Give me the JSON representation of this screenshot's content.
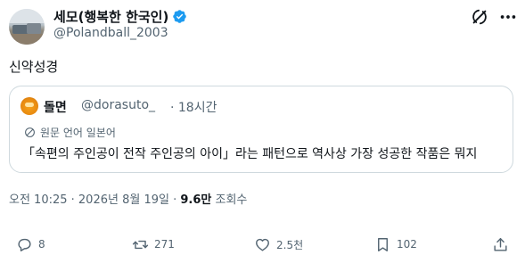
{
  "author": {
    "display_name": "세모(행복한 한국인)",
    "handle": "@Polandball_2003",
    "verified_icon": "verified-badge-icon",
    "verified_color": "#1d9bf0"
  },
  "tweet": {
    "text": "신약성경"
  },
  "quote": {
    "name": "돌면",
    "handle": "@dorasuto_",
    "time": "· 18시간",
    "language_note": "원문 언어 일본어",
    "text": "「속편의 주인공이 전작 주인공의 아이」라는 패턴으로 역사상 가장 성공한 작품은 뭐지"
  },
  "meta": {
    "timestamp": "오전 10:25 · 2026년 8월 19일 · ",
    "views_count": "9.6만",
    "views_label": " 조회수"
  },
  "actions": {
    "reply_count": "8",
    "retweet_count": "271",
    "like_count": "2.5천",
    "bookmark_count": "102"
  },
  "colors": {
    "text": "#0f1419",
    "secondary": "#536471",
    "border": "#cfd9de"
  }
}
